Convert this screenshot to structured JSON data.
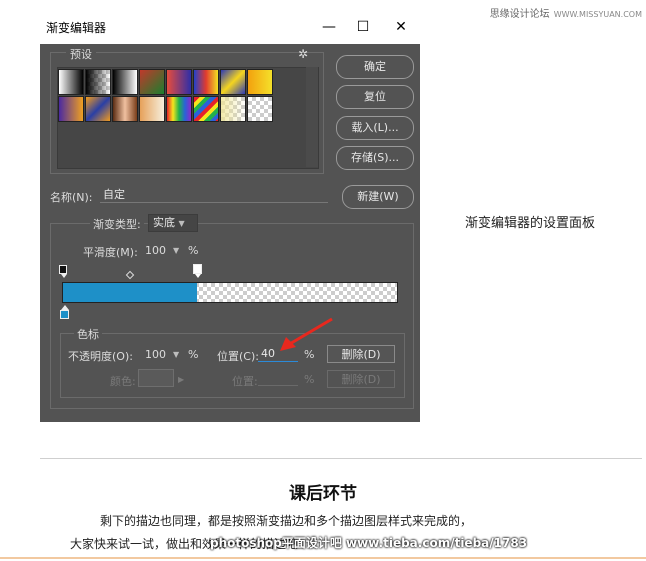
{
  "watermark": {
    "brand": "思缘设计论坛",
    "site": "WWW.MISSYUAN.COM"
  },
  "dialog": {
    "title": "渐变编辑器",
    "minimize": "—",
    "maximize": "☐",
    "close": "✕",
    "presets_label": "预设",
    "gear": "✲",
    "buttons": {
      "ok": "确定",
      "reset": "复位",
      "load": "载入(L)...",
      "save": "存储(S)...",
      "new": "新建(W)"
    },
    "name_label": "名称(N):",
    "name_value": "自定",
    "type_label": "渐变类型:",
    "type_value": "实底",
    "smooth_label": "平滑度(M):",
    "smooth_value": "100",
    "smooth_unit": "%",
    "stops_group": "色标",
    "opacity_label": "不透明度(O):",
    "opacity_value": "100",
    "opacity_unit": "%",
    "location_label": "位置(C):",
    "location_value": "40",
    "location_unit": "%",
    "delete_label": "删除(D)",
    "color_label": "颜色:",
    "color_location_label": "位置:",
    "color_location_unit": "%",
    "color_delete_label": "删除(D)",
    "gradient": {
      "color": "#1e90c8",
      "stop_fraction": 0.4
    }
  },
  "caption": "渐变编辑器的设置面板",
  "section": {
    "heading": "课后环节",
    "para1": "剩下的描边也同理，都是按照渐变描边和多个描边图层样式来完成的，",
    "para2": "大家快来试一试，做出和效果一样的描边吧！",
    "bottom_watermark": "photoshop平面设计吧 www.tieba.com/tieba/1783"
  }
}
